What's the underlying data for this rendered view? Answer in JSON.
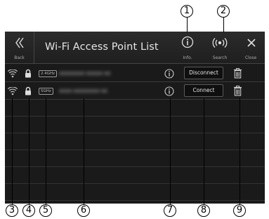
{
  "callouts": [
    "1",
    "2",
    "3",
    "4",
    "5",
    "6",
    "7",
    "8",
    "9"
  ],
  "header": {
    "back_label": "Back",
    "title": "Wi-Fi Access Point List",
    "info_label": "Info.",
    "search_label": "Search",
    "close_label": "Close"
  },
  "networks": [
    {
      "band": "2.4GHz",
      "ssid": "xxxxxxxx-xxxxx-xx",
      "action": "Disconnect"
    },
    {
      "band": "5GHz",
      "ssid": "xxxx-xxxxxxxx-xx",
      "action": "Connect"
    }
  ]
}
